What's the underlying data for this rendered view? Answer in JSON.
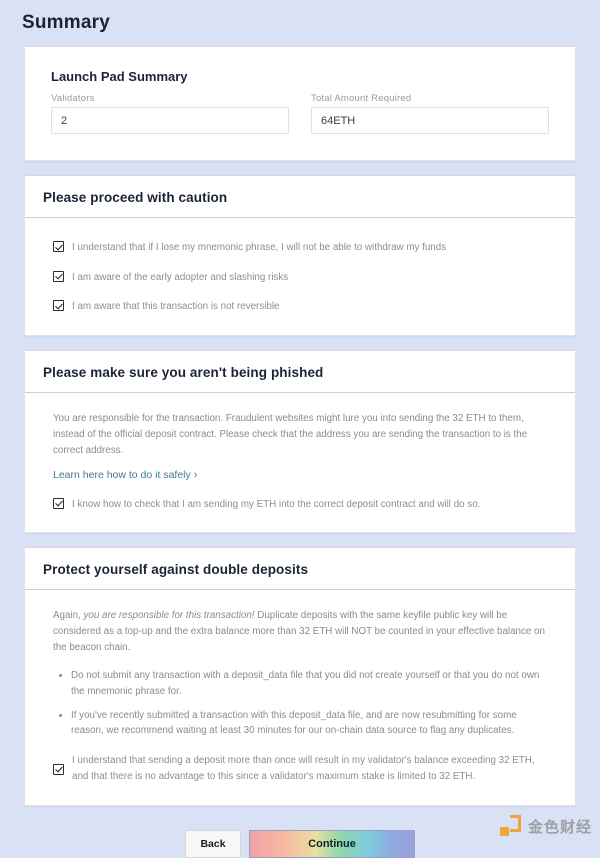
{
  "page": {
    "title": "Summary",
    "background_color": "#d9e2f5"
  },
  "summary_card": {
    "title": "Launch Pad Summary",
    "fields": [
      {
        "label": "Validators",
        "value": "2"
      },
      {
        "label": "Total Amount Required",
        "value": "64ETH"
      }
    ]
  },
  "caution_card": {
    "heading": "Please proceed with caution",
    "checkboxes": [
      {
        "label": "I understand that if I lose my mnemonic phrase, I will not be able to withdraw my funds",
        "checked": true
      },
      {
        "label": "I am aware of the early adopter and slashing risks",
        "checked": true
      },
      {
        "label": "I am aware that this transaction is not reversible",
        "checked": true
      }
    ]
  },
  "phishing_card": {
    "heading": "Please make sure you aren't being phished",
    "paragraph": "You are responsible for the transaction. Fraudulent websites might lure you into sending the 32 ETH to them, instead of the official deposit contract. Please check that the address you are sending the transaction to is the correct address.",
    "link_label": "Learn here how to do it safely",
    "link_chevron": "›",
    "link_color": "#3f7a91",
    "checkbox": {
      "label": "I know how to check that I am sending my ETH into the correct deposit contract and will do so.",
      "checked": true
    }
  },
  "double_deposit_card": {
    "heading": "Protect yourself against double deposits",
    "paragraph_lead": "Again, ",
    "paragraph_italic": "you are responsible for this transaction!",
    "paragraph_rest": " Duplicate deposits with the same keyfile public key will be considered as a top-up and the extra balance more than 32 ETH will NOT be counted in your effective balance on the beacon chain.",
    "bullets": [
      "Do not submit any transaction with a deposit_data file that you did not create yourself or that you do not own the mnemonic phrase for.",
      "If you've recently submitted a transaction with this deposit_data file, and are now resubmitting for some reason, we recommend waiting at least 30 minutes for our on-chain data source to flag any duplicates."
    ],
    "checkbox": {
      "label": "I understand that sending a deposit more than once will result in my validator's balance exceeding 32 ETH, and that there is no advantage to this since a validator's maximum stake is limited to 32 ETH.",
      "checked": true
    }
  },
  "footer": {
    "back_label": "Back",
    "continue_label": "Continue",
    "continue_gradient": [
      "#f2a0a8",
      "#f6bba0",
      "#e8dfa0",
      "#8fd7a8",
      "#7ecbdc",
      "#8fa8df",
      "#9aa0dc"
    ]
  },
  "watermark": {
    "text": "金色财经",
    "color": "#f0a030"
  }
}
